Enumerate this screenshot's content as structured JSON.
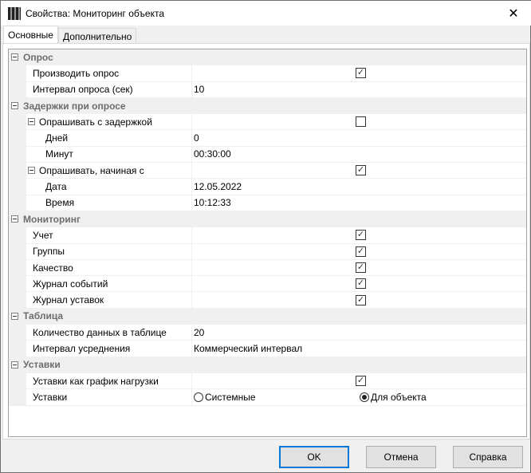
{
  "window": {
    "title": "Свойства: Мониторинг объекта",
    "close": "✕"
  },
  "tabs": [
    "Основные",
    "Дополнительно"
  ],
  "rows": [
    {
      "t": "cat",
      "name": "Опрос"
    },
    {
      "t": "prop",
      "name": "Производить опрос",
      "check": true
    },
    {
      "t": "prop",
      "name": "Интервал опроса (сек)",
      "value": "10"
    },
    {
      "t": "cat",
      "name": "Задержки при опросе"
    },
    {
      "t": "sub",
      "name": "Опрашивать с задержкой",
      "check": false
    },
    {
      "t": "prop2",
      "name": "Дней",
      "value": "0"
    },
    {
      "t": "prop2",
      "name": "Минут",
      "value": "00:30:00"
    },
    {
      "t": "sub",
      "name": "Опрашивать, начиная с",
      "check": true
    },
    {
      "t": "prop2",
      "name": "Дата",
      "value": "12.05.2022"
    },
    {
      "t": "prop2",
      "name": "Время",
      "value": "10:12:33"
    },
    {
      "t": "cat",
      "name": "Мониторинг"
    },
    {
      "t": "prop",
      "name": "Учет",
      "check": true
    },
    {
      "t": "prop",
      "name": "Группы",
      "check": true
    },
    {
      "t": "prop",
      "name": "Качество",
      "check": true
    },
    {
      "t": "prop",
      "name": "Журнал событий",
      "check": true
    },
    {
      "t": "prop",
      "name": "Журнал уставок",
      "check": true
    },
    {
      "t": "cat",
      "name": "Таблица"
    },
    {
      "t": "prop",
      "name": "Количество данных в таблице",
      "value": "20"
    },
    {
      "t": "prop",
      "name": "Интервал усреднения",
      "value": "Коммерческий интервал"
    },
    {
      "t": "cat",
      "name": "Уставки"
    },
    {
      "t": "prop",
      "name": "Уставки как график нагрузки",
      "check": true
    },
    {
      "t": "radio",
      "name": "Уставки",
      "options": [
        "Системные",
        "Для объекта"
      ],
      "selected": 1
    }
  ],
  "buttons": {
    "ok": "OK",
    "cancel": "Отмена",
    "help": "Справка"
  }
}
